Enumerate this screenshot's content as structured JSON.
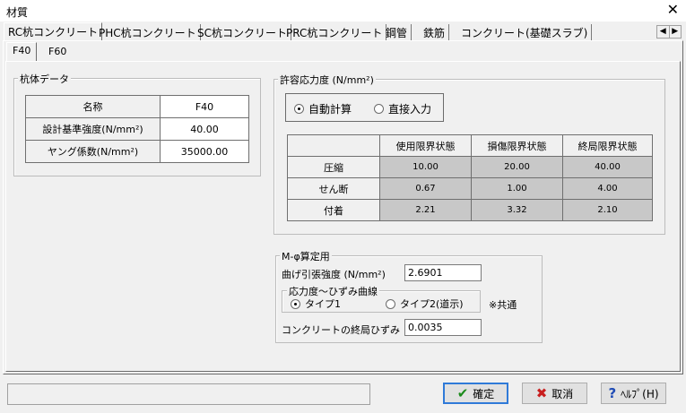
{
  "window": {
    "title": "材質"
  },
  "tabs": [
    "RC杭コンクリート",
    "PHC杭コンクリート",
    "SC杭コンクリート",
    "PRC杭コンクリート",
    "鋼管",
    "鉄筋",
    "コンクリート(基礎スラブ)"
  ],
  "sub_tabs": [
    "F40",
    "F60"
  ],
  "pile_data": {
    "group_label": "杭体データ",
    "rows": [
      {
        "label": "名称",
        "value": "F40"
      },
      {
        "label": "設計基準強度(N/mm²)",
        "value": "40.00"
      },
      {
        "label": "ヤング係数(N/mm²)",
        "value": "35000.00"
      }
    ]
  },
  "allowable_stress": {
    "group_label": "許容応力度 (N/mm²)",
    "radio_auto": "自動計算",
    "radio_direct": "直接入力",
    "selected": "自動計算",
    "columns": [
      "使用限界状態",
      "損傷限界状態",
      "終局限界状態"
    ],
    "rows": [
      {
        "label": "圧縮",
        "values": [
          "10.00",
          "20.00",
          "40.00"
        ]
      },
      {
        "label": "せん断",
        "values": [
          "0.67",
          "1.00",
          "4.00"
        ]
      },
      {
        "label": "付着",
        "values": [
          "2.21",
          "3.32",
          "2.10"
        ]
      }
    ]
  },
  "m_phi": {
    "group_label": "M-φ算定用",
    "tensile_label": "曲げ引張強度 (N/mm²)",
    "tensile_value": "2.6901",
    "curve_group_label": "応力度～ひずみ曲線",
    "type1": "タイプ1",
    "type2": "タイプ2(道示)",
    "selected": "タイプ1",
    "common_note": "※共通",
    "ultimate_strain_label": "コンクリートの終局ひずみ",
    "ultimate_strain_value": "0.0035"
  },
  "buttons": {
    "ok": "確定",
    "cancel": "取消",
    "help": "ﾍﾙﾌﾟ(H)"
  },
  "icons": {
    "close": "close-icon",
    "ok": "check-icon",
    "cancel": "x-icon",
    "help": "question-icon"
  }
}
